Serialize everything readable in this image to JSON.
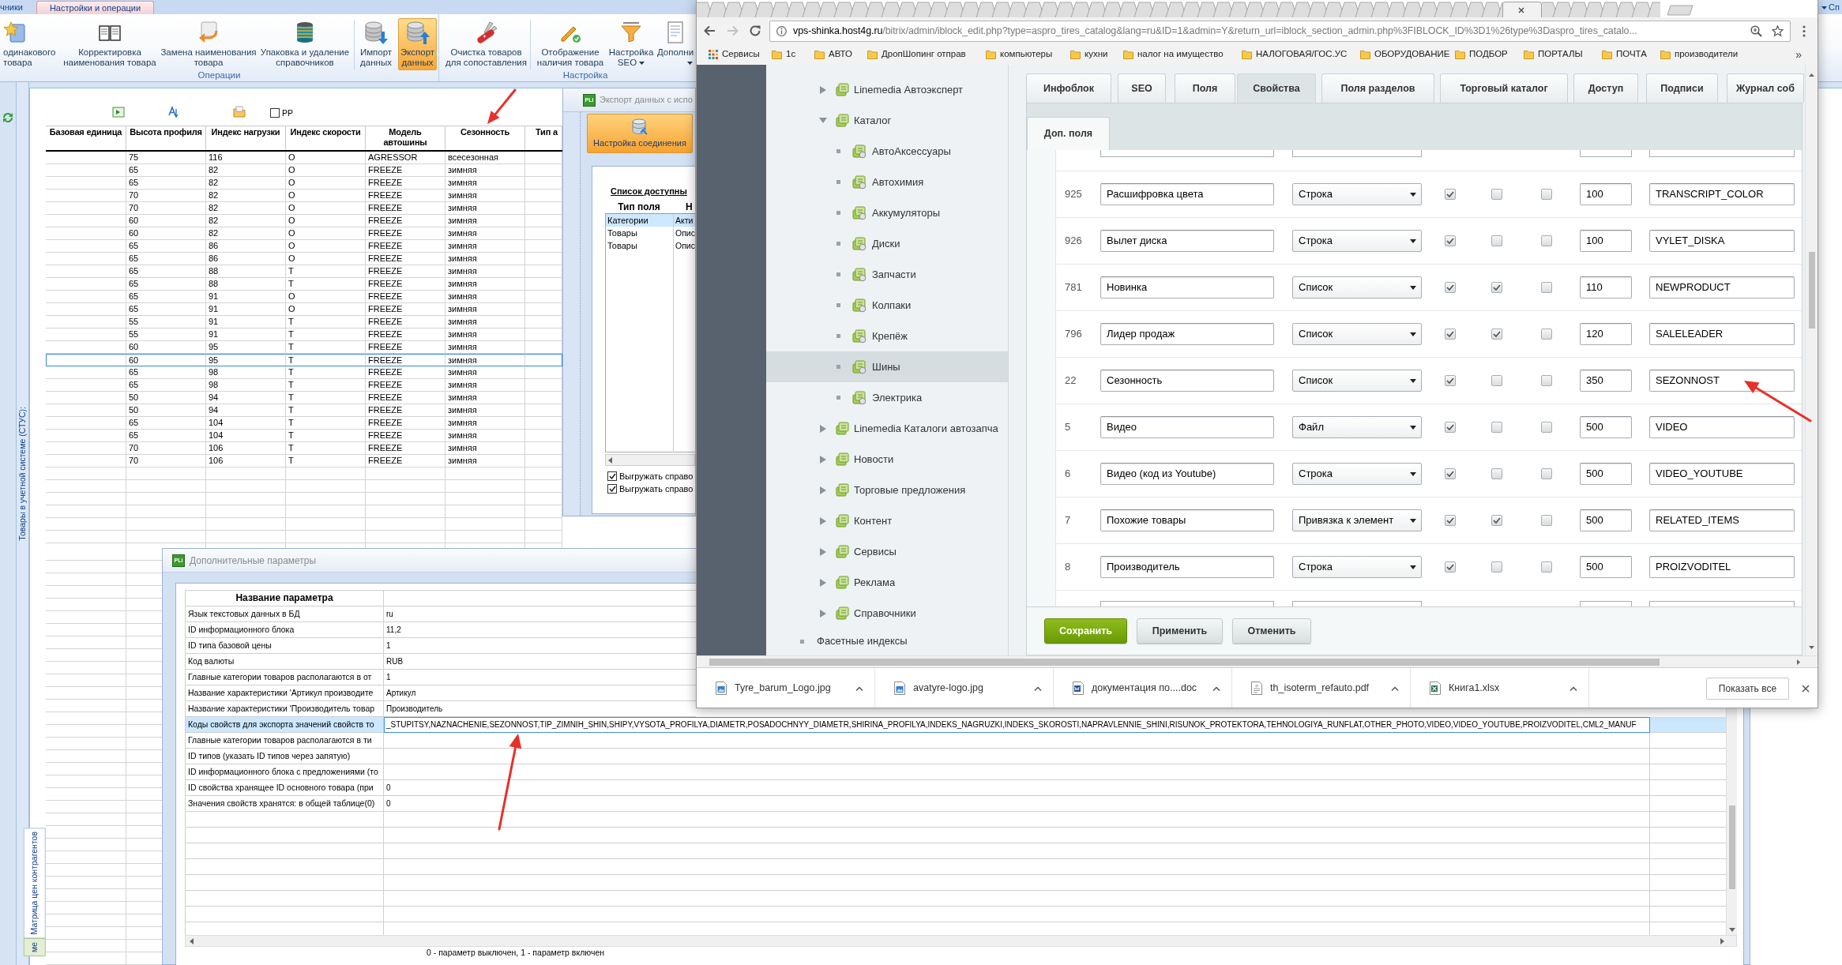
{
  "app": {
    "ribbon_tabs": [
      {
        "label": "чники",
        "selected": false
      },
      {
        "label": "Настройки и операции",
        "selected": true
      }
    ],
    "ribbon_corner": {
      "label": "Сп"
    },
    "ribbon_groups": [
      {
        "label": "Операции",
        "buttons": [
          {
            "lines": [
              "одинакового",
              "товара"
            ],
            "selected": false,
            "dropdown": false
          },
          {
            "lines": [
              "Корректировка",
              "наименования товара"
            ],
            "selected": false,
            "dropdown": false
          },
          {
            "lines": [
              "Замена наименования",
              "товара"
            ],
            "selected": false,
            "dropdown": false
          },
          {
            "lines": [
              "Упаковка и удаление",
              "справочников"
            ],
            "selected": false,
            "dropdown": false
          },
          {
            "lines": [
              "Импорт",
              "данных"
            ],
            "selected": false,
            "dropdown": false
          },
          {
            "lines": [
              "Экспорт",
              "данных"
            ],
            "selected": true,
            "dropdown": false
          }
        ]
      },
      {
        "label": "Настройка",
        "buttons": [
          {
            "lines": [
              "Очистка товаров",
              "для сопоставления"
            ],
            "selected": false,
            "dropdown": false
          },
          {
            "lines": [
              "Отображение",
              "наличия товара"
            ],
            "selected": false,
            "dropdown": false
          },
          {
            "lines": [
              "Настройка",
              "SEO"
            ],
            "selected": false,
            "dropdown": true
          },
          {
            "lines": [
              "Дополни"
            ],
            "selected": false,
            "dropdown": true
          }
        ]
      }
    ],
    "side_tab": {
      "label": "Товары в учетной системе (СТУС):"
    },
    "bottom_tabs": [
      {
        "label": "Матрица цен контрагентов",
        "selected": false
      },
      {
        "label": "ме",
        "selected": true
      }
    ],
    "toolbar": {
      "checkbox": {
        "label": "PP",
        "checked": false
      }
    },
    "table": {
      "columns": [
        {
          "lines": [
            "Базовая единица"
          ]
        },
        {
          "lines": [
            "Высота профиля"
          ]
        },
        {
          "lines": [
            "Индекс нагрузки"
          ]
        },
        {
          "lines": [
            "Индекс скорости"
          ]
        },
        {
          "lines": [
            "Модель",
            "автошины"
          ]
        },
        {
          "lines": [
            "Сезонность"
          ]
        },
        {
          "lines": [
            "Тип а"
          ]
        }
      ],
      "rows": [
        {
          "cells": [
            "",
            "75",
            "116",
            "O",
            "AGRESSOR",
            "всесезонная",
            ""
          ],
          "selected": false
        },
        {
          "cells": [
            "",
            "65",
            "82",
            "O",
            "FREEZE",
            "зимняя",
            ""
          ],
          "selected": false
        },
        {
          "cells": [
            "",
            "65",
            "82",
            "O",
            "FREEZE",
            "зимняя",
            ""
          ],
          "selected": false
        },
        {
          "cells": [
            "",
            "70",
            "82",
            "O",
            "FREEZE",
            "зимняя",
            ""
          ],
          "selected": false
        },
        {
          "cells": [
            "",
            "70",
            "82",
            "O",
            "FREEZE",
            "зимняя",
            ""
          ],
          "selected": false
        },
        {
          "cells": [
            "",
            "60",
            "82",
            "O",
            "FREEZE",
            "зимняя",
            ""
          ],
          "selected": false
        },
        {
          "cells": [
            "",
            "60",
            "82",
            "O",
            "FREEZE",
            "зимняя",
            ""
          ],
          "selected": false
        },
        {
          "cells": [
            "",
            "65",
            "86",
            "O",
            "FREEZE",
            "зимняя",
            ""
          ],
          "selected": false
        },
        {
          "cells": [
            "",
            "65",
            "86",
            "O",
            "FREEZE",
            "зимняя",
            ""
          ],
          "selected": false
        },
        {
          "cells": [
            "",
            "65",
            "88",
            "T",
            "FREEZE",
            "зимняя",
            ""
          ],
          "selected": false
        },
        {
          "cells": [
            "",
            "65",
            "88",
            "T",
            "FREEZE",
            "зимняя",
            ""
          ],
          "selected": false
        },
        {
          "cells": [
            "",
            "65",
            "91",
            "O",
            "FREEZE",
            "зимняя",
            ""
          ],
          "selected": false
        },
        {
          "cells": [
            "",
            "65",
            "91",
            "O",
            "FREEZE",
            "зимняя",
            ""
          ],
          "selected": false
        },
        {
          "cells": [
            "",
            "55",
            "91",
            "T",
            "FREEZE",
            "зимняя",
            ""
          ],
          "selected": false
        },
        {
          "cells": [
            "",
            "55",
            "91",
            "T",
            "FREEZE",
            "зимняя",
            ""
          ],
          "selected": false
        },
        {
          "cells": [
            "",
            "60",
            "95",
            "T",
            "FREEZE",
            "зимняя",
            ""
          ],
          "selected": false
        },
        {
          "cells": [
            "",
            "60",
            "95",
            "T",
            "FREEZE",
            "зимняя",
            ""
          ],
          "selected": true
        },
        {
          "cells": [
            "",
            "65",
            "98",
            "T",
            "FREEZE",
            "зимняя",
            ""
          ],
          "selected": false
        },
        {
          "cells": [
            "",
            "65",
            "98",
            "T",
            "FREEZE",
            "зимняя",
            ""
          ],
          "selected": false
        },
        {
          "cells": [
            "",
            "50",
            "94",
            "T",
            "FREEZE",
            "зимняя",
            ""
          ],
          "selected": false
        },
        {
          "cells": [
            "",
            "50",
            "94",
            "T",
            "FREEZE",
            "зимняя",
            ""
          ],
          "selected": false
        },
        {
          "cells": [
            "",
            "65",
            "104",
            "T",
            "FREEZE",
            "зимняя",
            ""
          ],
          "selected": false
        },
        {
          "cells": [
            "",
            "65",
            "104",
            "T",
            "FREEZE",
            "зимняя",
            ""
          ],
          "selected": false
        },
        {
          "cells": [
            "",
            "70",
            "106",
            "T",
            "FREEZE",
            "зимняя",
            ""
          ],
          "selected": false
        },
        {
          "cells": [
            "",
            "70",
            "106",
            "T",
            "FREEZE",
            "зимняя",
            ""
          ],
          "selected": false
        }
      ]
    }
  },
  "export_window": {
    "logo": "PLi",
    "title": "Экспорт данных с испо",
    "connect_button": "Настройка соединения",
    "list_title": "Список доступны",
    "list_columns": [
      "Тип поля",
      "Н"
    ],
    "list_rows": [
      {
        "cells": [
          "Категории",
          "Акти"
        ],
        "selected": true
      },
      {
        "cells": [
          "Товары",
          "Опис"
        ],
        "selected": false
      },
      {
        "cells": [
          "Товары",
          "Опис"
        ],
        "selected": false
      }
    ],
    "options": [
      {
        "label": "Выгружать справо",
        "checked": true
      },
      {
        "label": "Выгружать справо",
        "checked": true
      }
    ]
  },
  "params_dialog": {
    "logo": "PLi",
    "title": "Дополнительные параметры",
    "column": "Название параметра",
    "rows": [
      {
        "name": "Язык текстовых данных в БД",
        "value": "ru",
        "selected": false
      },
      {
        "name": "ID информационного блока",
        "value": "11,2",
        "selected": false
      },
      {
        "name": "ID типа базовой цены",
        "value": "1",
        "selected": false
      },
      {
        "name": "Код валюты",
        "value": "RUB",
        "selected": false
      },
      {
        "name": "Главные категории товаров располагаются в от",
        "value": "1",
        "selected": false
      },
      {
        "name": "Название характеристики 'Артикул производите",
        "value": "Артикул",
        "selected": false
      },
      {
        "name": "Название характеристики 'Производитель товар",
        "value": "Производитель",
        "selected": false
      },
      {
        "name": "Коды свойств для экспорта значений свойств то",
        "value": "_STUPITSY,NAZNACHENIE,SEZONNOST,TIP_ZIMNIH_SHIN,SHIPY,VYSOTA_PROFILYA,DIAMETR,POSADOCHNYY_DIAMETR,SHIRINA_PROFILYA,INDEKS_NAGRUZKI,INDEKS_SKOROSTI,NAPRAVLENNIE_SHINI,RISUNOK_PROTEKTORA,TEHNOLOGIYA_RUNFLAT,OTHER_PHOTO,VIDEO,VIDEO_YOUTUBE,PROIZVODITEL,CML2_MANUF",
        "selected": true
      },
      {
        "name": "Главные категории товаров располагаются в ти",
        "selected": false
      },
      {
        "name": "ID типов (указать ID типов через запятую)",
        "selected": false
      },
      {
        "name": "ID информационного блока с предложениями (то",
        "selected": false
      },
      {
        "name": "ID свойства хранящее ID основного товара (при",
        "value": "0",
        "selected": false
      },
      {
        "name": "Значения свойств хранятся: в общей таблице(0)",
        "value": "0",
        "selected": false
      }
    ],
    "footer": "0 - параметр выключен, 1 - параметр включен"
  },
  "browser": {
    "url": {
      "host": "vps-shinka.host4g.ru",
      "path": "/bitrix/admin/iblock_edit.php?type=aspro_tires_catalog&lang=ru&ID=1&admin=Y&return_url=iblock_section_admin.php%3FIBLOCK_ID%3D1%26type%3Daspro_tires_catalo..."
    },
    "bookmarks": [
      {
        "label": "Сервисы",
        "kind": "apps"
      },
      {
        "label": "1с",
        "kind": "folder"
      },
      {
        "label": "АВТО",
        "kind": "folder"
      },
      {
        "label": "ДропШопинг отправ",
        "kind": "folder"
      },
      {
        "label": "компьютеры",
        "kind": "folder"
      },
      {
        "label": "кухни",
        "kind": "folder"
      },
      {
        "label": "налог на имущество",
        "kind": "folder"
      },
      {
        "label": "НАЛОГОВАЯ/ГОС.УС",
        "kind": "folder"
      },
      {
        "label": "ОБОРУДОВАНИЕ",
        "kind": "folder"
      },
      {
        "label": "ПОДБОР",
        "kind": "folder"
      },
      {
        "label": "ПОРТАЛЫ",
        "kind": "folder"
      },
      {
        "label": "ПОЧТА",
        "kind": "folder"
      },
      {
        "label": "производители",
        "kind": "folder"
      }
    ],
    "bookmarks_more": "»",
    "tree": {
      "items": [
        {
          "label": "Linemedia Автоэксперт",
          "expanded": false,
          "selected": false
        },
        {
          "label": "Каталог",
          "expanded": true,
          "selected": false,
          "children": [
            {
              "label": "АвтоАксессуары",
              "selected": false
            },
            {
              "label": "Автохимия",
              "selected": false
            },
            {
              "label": "Аккумуляторы",
              "selected": false
            },
            {
              "label": "Диски",
              "selected": false
            },
            {
              "label": "Запчасти",
              "selected": false
            },
            {
              "label": "Колпаки",
              "selected": false
            },
            {
              "label": "Крепёж",
              "selected": false
            },
            {
              "label": "Шины",
              "selected": true
            },
            {
              "label": "Электрика",
              "selected": false
            }
          ]
        },
        {
          "label": "Linemedia Каталоги автозапча",
          "expanded": false,
          "selected": false
        },
        {
          "label": "Новости",
          "expanded": false,
          "selected": false
        },
        {
          "label": "Торговые предложения",
          "expanded": false,
          "selected": false
        },
        {
          "label": "Контент",
          "expanded": false,
          "selected": false
        },
        {
          "label": "Сервисы",
          "expanded": false,
          "selected": false
        },
        {
          "label": "Реклама",
          "expanded": false,
          "selected": false
        },
        {
          "label": "Справочники",
          "expanded": false,
          "selected": false
        }
      ],
      "root_items": [
        {
          "label": "Фасетные индексы",
          "selected": false
        }
      ]
    },
    "tabs": [
      {
        "label": "Инфоблок",
        "selected": false
      },
      {
        "label": "SEO",
        "selected": false
      },
      {
        "label": "Поля",
        "selected": false
      },
      {
        "label": "Свойства",
        "selected": true
      },
      {
        "label": "Поля разделов",
        "selected": false
      },
      {
        "label": "Торговый каталог",
        "selected": false
      },
      {
        "label": "Доступ",
        "selected": false
      },
      {
        "label": "Подписи",
        "selected": false
      },
      {
        "label": "Журнал соб",
        "selected": false
      }
    ],
    "subtabs": [
      {
        "label": "Доп. поля",
        "selected": true
      }
    ],
    "properties": [
      {
        "id": "925",
        "name": "Расшифровка цвета",
        "type": "Строка",
        "flags": [
          {
            "checked": true
          },
          {
            "checked": false
          },
          {
            "checked": false
          }
        ],
        "sort": "100",
        "code": "TRANSCRIPT_COLOR"
      },
      {
        "id": "926",
        "name": "Вылет диска",
        "type": "Строка",
        "flags": [
          {
            "checked": true
          },
          {
            "checked": false
          },
          {
            "checked": false
          }
        ],
        "sort": "100",
        "code": "VYLET_DISKA"
      },
      {
        "id": "781",
        "name": "Новинка",
        "type": "Список",
        "flags": [
          {
            "checked": true
          },
          {
            "checked": true
          },
          {
            "checked": false
          }
        ],
        "sort": "110",
        "code": "NEWPRODUCT"
      },
      {
        "id": "796",
        "name": "Лидер продаж",
        "type": "Список",
        "flags": [
          {
            "checked": true
          },
          {
            "checked": true
          },
          {
            "checked": false
          }
        ],
        "sort": "120",
        "code": "SALELEADER"
      },
      {
        "id": "22",
        "name": "Сезонность",
        "type": "Список",
        "flags": [
          {
            "checked": true
          },
          {
            "checked": false
          },
          {
            "checked": false
          }
        ],
        "sort": "350",
        "code": "SEZONNOST"
      },
      {
        "id": "5",
        "name": "Видео",
        "type": "Файл",
        "flags": [
          {
            "checked": true
          },
          {
            "checked": false
          },
          {
            "checked": false
          }
        ],
        "sort": "500",
        "code": "VIDEO"
      },
      {
        "id": "6",
        "name": "Видео (код из Youtube)",
        "type": "Строка",
        "flags": [
          {
            "checked": true
          },
          {
            "checked": false
          },
          {
            "checked": false
          }
        ],
        "sort": "500",
        "code": "VIDEO_YOUTUBE"
      },
      {
        "id": "7",
        "name": "Похожие товары",
        "type": "Привязка к элемент",
        "flags": [
          {
            "checked": true
          },
          {
            "checked": true
          },
          {
            "checked": false
          }
        ],
        "sort": "500",
        "code": "RELATED_ITEMS"
      },
      {
        "id": "8",
        "name": "Производитель",
        "type": "Строка",
        "flags": [
          {
            "checked": true
          },
          {
            "checked": false
          },
          {
            "checked": false
          }
        ],
        "sort": "500",
        "code": "PROIZVODITEL"
      }
    ],
    "buttons": [
      {
        "label": "Сохранить",
        "kind": "primary"
      },
      {
        "label": "Применить",
        "kind": "secondary"
      },
      {
        "label": "Отменить",
        "kind": "secondary"
      }
    ],
    "downloads": [
      {
        "file": "Tyre_barum_Logo.jpg",
        "kind": "image"
      },
      {
        "file": "avatyre-logo.jpg",
        "kind": "image"
      },
      {
        "file": "документация по....doc",
        "kind": "word"
      },
      {
        "file": "th_isoterm_refauto.pdf",
        "kind": "pdf"
      },
      {
        "file": "Книга1.xlsx",
        "kind": "excel"
      }
    ],
    "show_all": "Показать все"
  }
}
